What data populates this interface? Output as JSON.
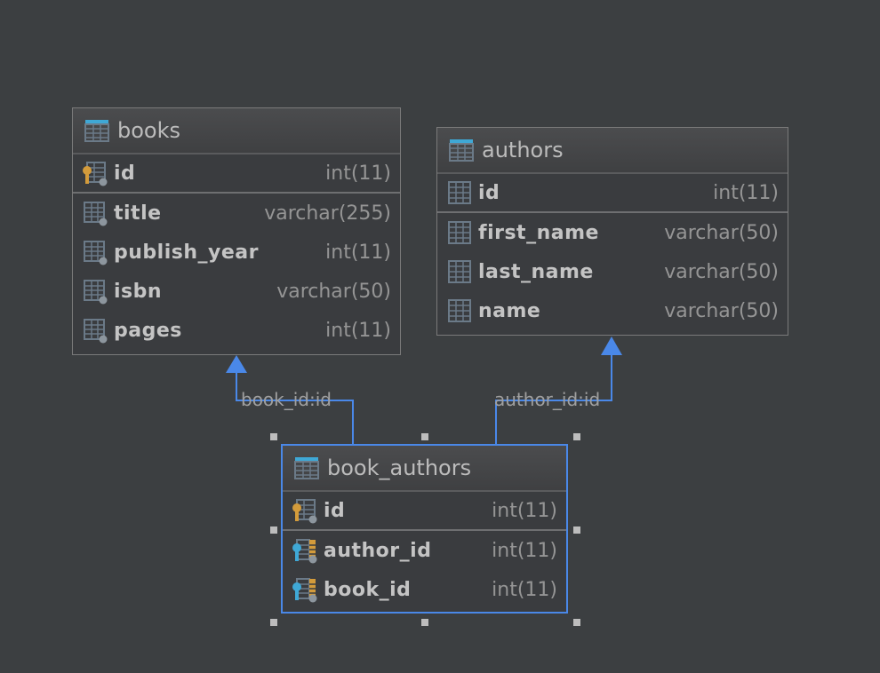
{
  "tables": [
    {
      "name": "books",
      "pk": [
        {
          "name": "id",
          "type": "int(11)",
          "icon": "primary-key-column-icon"
        }
      ],
      "columns": [
        {
          "name": "title",
          "type": "varchar(255)",
          "icon": "column-icon"
        },
        {
          "name": "publish_year",
          "type": "int(11)",
          "icon": "column-icon"
        },
        {
          "name": "isbn",
          "type": "varchar(50)",
          "icon": "column-icon"
        },
        {
          "name": "pages",
          "type": "int(11)",
          "icon": "column-icon"
        }
      ]
    },
    {
      "name": "authors",
      "pk": [
        {
          "name": "id",
          "type": "int(11)",
          "icon": "column-icon"
        }
      ],
      "columns": [
        {
          "name": "first_name",
          "type": "varchar(50)",
          "icon": "column-icon"
        },
        {
          "name": "last_name",
          "type": "varchar(50)",
          "icon": "column-icon"
        },
        {
          "name": "name",
          "type": "varchar(50)",
          "icon": "column-icon"
        }
      ]
    },
    {
      "name": "book_authors",
      "selected": true,
      "pk": [
        {
          "name": "id",
          "type": "int(11)",
          "icon": "primary-key-column-icon"
        }
      ],
      "columns": [
        {
          "name": "author_id",
          "type": "int(11)",
          "icon": "foreign-key-column-icon"
        },
        {
          "name": "book_id",
          "type": "int(11)",
          "icon": "foreign-key-column-icon"
        }
      ]
    }
  ],
  "relations": [
    {
      "label": "book_id:id",
      "from": "book_authors",
      "to": "books"
    },
    {
      "label": "author_id:id",
      "from": "book_authors",
      "to": "authors"
    }
  ],
  "colors": {
    "background": "#3c3f41",
    "relation_line": "#4a88e8",
    "table_header_icon": "#3fa8d6",
    "primary_key": "#d39b3b",
    "foreign_key": "#3fa8d6"
  }
}
